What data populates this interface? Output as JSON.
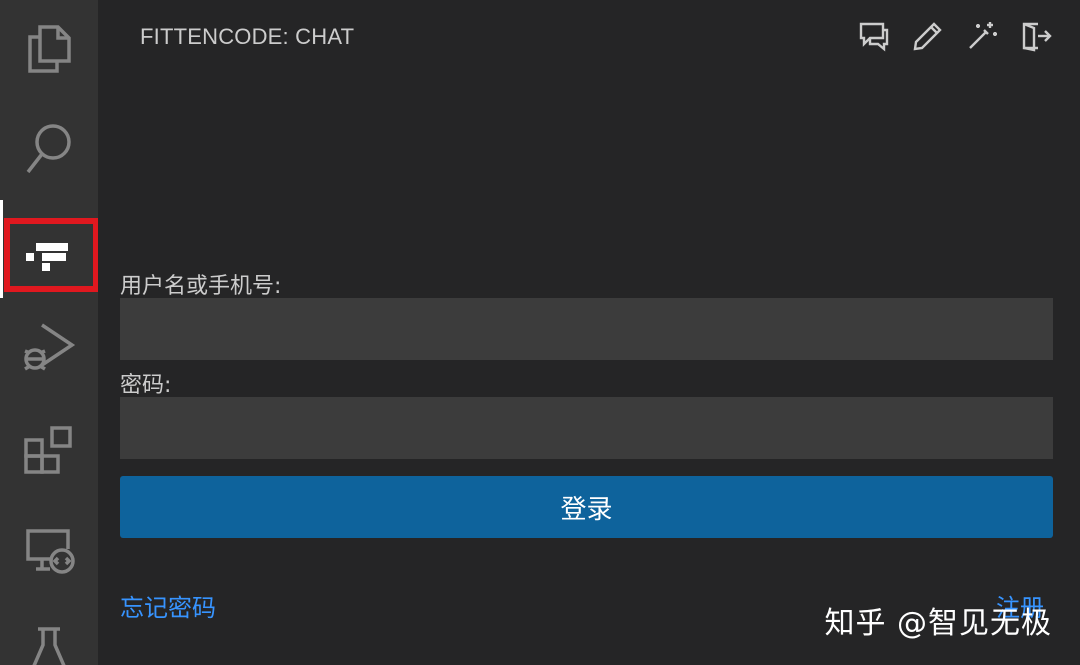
{
  "panel": {
    "title": "FITTENCODE: CHAT"
  },
  "activity_bar": {
    "items": [
      {
        "icon": "files-icon"
      },
      {
        "icon": "search-icon"
      },
      {
        "icon": "fittencode-icon",
        "active": true,
        "highlighted": true
      },
      {
        "icon": "run-debug-icon"
      },
      {
        "icon": "extensions-icon"
      },
      {
        "icon": "remote-explorer-icon"
      },
      {
        "icon": "testing-flask-icon"
      }
    ]
  },
  "toolbar": {
    "buttons": [
      {
        "icon": "chat-icon"
      },
      {
        "icon": "edit-pencil-icon"
      },
      {
        "icon": "magic-wand-icon"
      },
      {
        "icon": "logout-icon"
      }
    ]
  },
  "login_form": {
    "username_label": "用户名或手机号:",
    "username_value": "",
    "password_label": "密码:",
    "password_value": "",
    "submit_label": "登录",
    "forgot_password_link": "忘记密码",
    "register_link": "注册"
  },
  "watermark": {
    "text": "知乎 @智见无极"
  },
  "colors": {
    "activity_bar_bg": "#333333",
    "panel_bg": "#252526",
    "input_bg": "#3c3c3c",
    "button_bg": "#0e639c",
    "link": "#3794ff",
    "highlight_border": "#e0181f"
  }
}
